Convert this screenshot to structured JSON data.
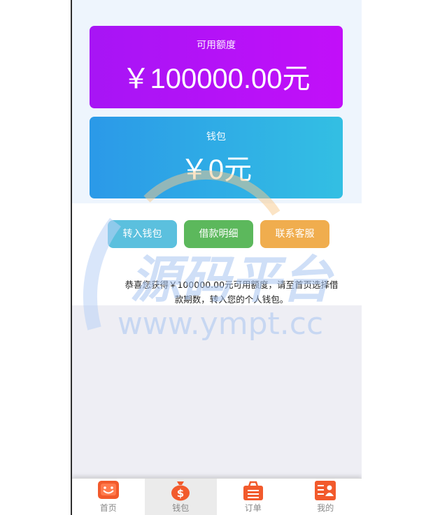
{
  "quota_card": {
    "label": "可用额度",
    "amount": "￥100000.00元"
  },
  "wallet_card": {
    "label": "钱包",
    "amount": "￥0元"
  },
  "actions": {
    "transfer": "转入钱包",
    "detail": "借款明细",
    "service": "联系客服"
  },
  "message": "恭喜您获得￥100000.00元可用额度，请至首页选择借款期数，转入您的个人钱包。",
  "watermark": {
    "text": "源码平台",
    "url": "www.ympt.cc"
  },
  "tabbar": {
    "active": "wallet",
    "items": [
      {
        "key": "home",
        "label": "首页",
        "icon": "smiley-box-icon"
      },
      {
        "key": "wallet",
        "label": "钱包",
        "icon": "money-bag-icon"
      },
      {
        "key": "orders",
        "label": "订单",
        "icon": "basket-icon"
      },
      {
        "key": "mine",
        "label": "我的",
        "icon": "profile-card-icon"
      }
    ]
  },
  "colors": {
    "quota_gradient": [
      "#a715f5",
      "#c20ff9"
    ],
    "wallet_gradient": [
      "#2b99e8",
      "#33bfe3"
    ],
    "transfer_btn": "#5bc0de",
    "detail_btn": "#5cb85c",
    "service_btn": "#f0ad4e",
    "tab_icon": "#f25a2c"
  }
}
